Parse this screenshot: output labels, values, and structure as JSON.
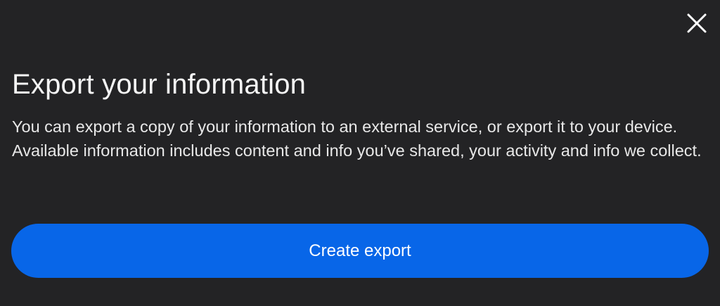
{
  "dialog": {
    "title": "Export your information",
    "description": "You can export a copy of your information to an external service, or export it to your device. Available information includes content and info you’ve shared, your activity and info we collect.",
    "primary_button_label": "Create export",
    "close_icon": "close-icon"
  },
  "colors": {
    "background": "#232325",
    "accent": "#0866e8",
    "text": "#f5f5f5"
  }
}
